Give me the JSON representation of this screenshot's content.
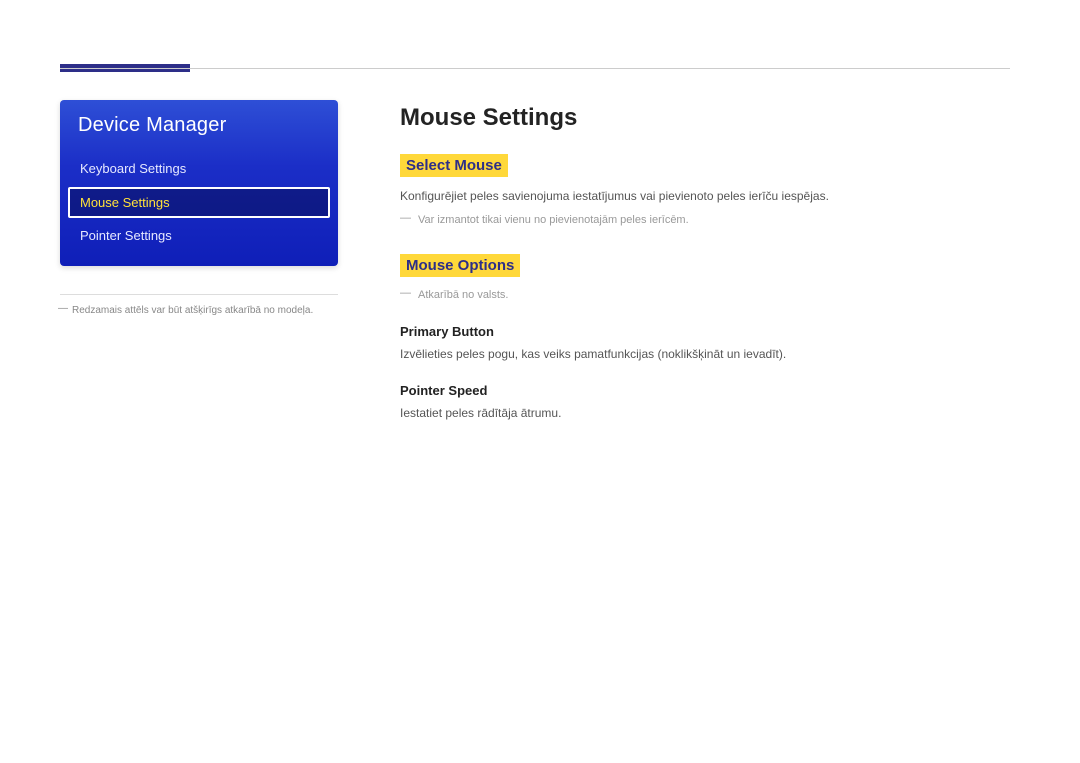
{
  "sidebar": {
    "title": "Device Manager",
    "items": [
      {
        "label": "Keyboard Settings",
        "active": false
      },
      {
        "label": "Mouse Settings",
        "active": true
      },
      {
        "label": "Pointer Settings",
        "active": false
      }
    ],
    "caption": "Redzamais attēls var būt atšķirīgs atkarībā no modeļa."
  },
  "content": {
    "title": "Mouse Settings",
    "select_mouse": {
      "heading": "Select Mouse",
      "desc": "Konfigurējiet peles savienojuma iestatījumus vai pievienoto peles ierīču iespējas.",
      "note": "Var izmantot tikai vienu no pievienotajām peles ierīcēm."
    },
    "mouse_options": {
      "heading": "Mouse Options",
      "note": "Atkarībā no valsts.",
      "primary_button": {
        "heading": "Primary Button",
        "desc": "Izvēlieties peles pogu, kas veiks pamatfunkcijas (noklikšķināt un ievadīt)."
      },
      "pointer_speed": {
        "heading": "Pointer Speed",
        "desc": "Iestatiet peles rādītāja ātrumu."
      }
    }
  }
}
